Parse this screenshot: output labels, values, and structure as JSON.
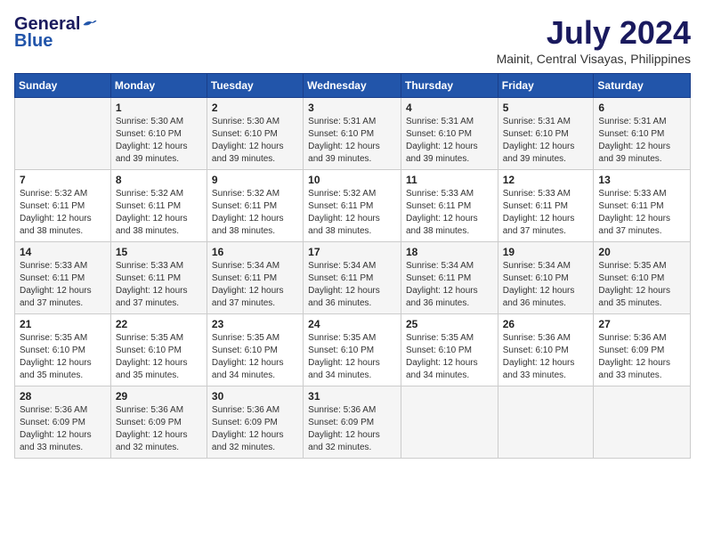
{
  "logo": {
    "general": "General",
    "blue": "Blue"
  },
  "title": "July 2024",
  "location": "Mainit, Central Visayas, Philippines",
  "headers": [
    "Sunday",
    "Monday",
    "Tuesday",
    "Wednesday",
    "Thursday",
    "Friday",
    "Saturday"
  ],
  "weeks": [
    [
      {
        "day": "",
        "info": ""
      },
      {
        "day": "1",
        "info": "Sunrise: 5:30 AM\nSunset: 6:10 PM\nDaylight: 12 hours\nand 39 minutes."
      },
      {
        "day": "2",
        "info": "Sunrise: 5:30 AM\nSunset: 6:10 PM\nDaylight: 12 hours\nand 39 minutes."
      },
      {
        "day": "3",
        "info": "Sunrise: 5:31 AM\nSunset: 6:10 PM\nDaylight: 12 hours\nand 39 minutes."
      },
      {
        "day": "4",
        "info": "Sunrise: 5:31 AM\nSunset: 6:10 PM\nDaylight: 12 hours\nand 39 minutes."
      },
      {
        "day": "5",
        "info": "Sunrise: 5:31 AM\nSunset: 6:10 PM\nDaylight: 12 hours\nand 39 minutes."
      },
      {
        "day": "6",
        "info": "Sunrise: 5:31 AM\nSunset: 6:10 PM\nDaylight: 12 hours\nand 39 minutes."
      }
    ],
    [
      {
        "day": "7",
        "info": "Sunrise: 5:32 AM\nSunset: 6:11 PM\nDaylight: 12 hours\nand 38 minutes."
      },
      {
        "day": "8",
        "info": "Sunrise: 5:32 AM\nSunset: 6:11 PM\nDaylight: 12 hours\nand 38 minutes."
      },
      {
        "day": "9",
        "info": "Sunrise: 5:32 AM\nSunset: 6:11 PM\nDaylight: 12 hours\nand 38 minutes."
      },
      {
        "day": "10",
        "info": "Sunrise: 5:32 AM\nSunset: 6:11 PM\nDaylight: 12 hours\nand 38 minutes."
      },
      {
        "day": "11",
        "info": "Sunrise: 5:33 AM\nSunset: 6:11 PM\nDaylight: 12 hours\nand 38 minutes."
      },
      {
        "day": "12",
        "info": "Sunrise: 5:33 AM\nSunset: 6:11 PM\nDaylight: 12 hours\nand 37 minutes."
      },
      {
        "day": "13",
        "info": "Sunrise: 5:33 AM\nSunset: 6:11 PM\nDaylight: 12 hours\nand 37 minutes."
      }
    ],
    [
      {
        "day": "14",
        "info": "Sunrise: 5:33 AM\nSunset: 6:11 PM\nDaylight: 12 hours\nand 37 minutes."
      },
      {
        "day": "15",
        "info": "Sunrise: 5:33 AM\nSunset: 6:11 PM\nDaylight: 12 hours\nand 37 minutes."
      },
      {
        "day": "16",
        "info": "Sunrise: 5:34 AM\nSunset: 6:11 PM\nDaylight: 12 hours\nand 37 minutes."
      },
      {
        "day": "17",
        "info": "Sunrise: 5:34 AM\nSunset: 6:11 PM\nDaylight: 12 hours\nand 36 minutes."
      },
      {
        "day": "18",
        "info": "Sunrise: 5:34 AM\nSunset: 6:11 PM\nDaylight: 12 hours\nand 36 minutes."
      },
      {
        "day": "19",
        "info": "Sunrise: 5:34 AM\nSunset: 6:10 PM\nDaylight: 12 hours\nand 36 minutes."
      },
      {
        "day": "20",
        "info": "Sunrise: 5:35 AM\nSunset: 6:10 PM\nDaylight: 12 hours\nand 35 minutes."
      }
    ],
    [
      {
        "day": "21",
        "info": "Sunrise: 5:35 AM\nSunset: 6:10 PM\nDaylight: 12 hours\nand 35 minutes."
      },
      {
        "day": "22",
        "info": "Sunrise: 5:35 AM\nSunset: 6:10 PM\nDaylight: 12 hours\nand 35 minutes."
      },
      {
        "day": "23",
        "info": "Sunrise: 5:35 AM\nSunset: 6:10 PM\nDaylight: 12 hours\nand 34 minutes."
      },
      {
        "day": "24",
        "info": "Sunrise: 5:35 AM\nSunset: 6:10 PM\nDaylight: 12 hours\nand 34 minutes."
      },
      {
        "day": "25",
        "info": "Sunrise: 5:35 AM\nSunset: 6:10 PM\nDaylight: 12 hours\nand 34 minutes."
      },
      {
        "day": "26",
        "info": "Sunrise: 5:36 AM\nSunset: 6:10 PM\nDaylight: 12 hours\nand 33 minutes."
      },
      {
        "day": "27",
        "info": "Sunrise: 5:36 AM\nSunset: 6:09 PM\nDaylight: 12 hours\nand 33 minutes."
      }
    ],
    [
      {
        "day": "28",
        "info": "Sunrise: 5:36 AM\nSunset: 6:09 PM\nDaylight: 12 hours\nand 33 minutes."
      },
      {
        "day": "29",
        "info": "Sunrise: 5:36 AM\nSunset: 6:09 PM\nDaylight: 12 hours\nand 32 minutes."
      },
      {
        "day": "30",
        "info": "Sunrise: 5:36 AM\nSunset: 6:09 PM\nDaylight: 12 hours\nand 32 minutes."
      },
      {
        "day": "31",
        "info": "Sunrise: 5:36 AM\nSunset: 6:09 PM\nDaylight: 12 hours\nand 32 minutes."
      },
      {
        "day": "",
        "info": ""
      },
      {
        "day": "",
        "info": ""
      },
      {
        "day": "",
        "info": ""
      }
    ]
  ]
}
